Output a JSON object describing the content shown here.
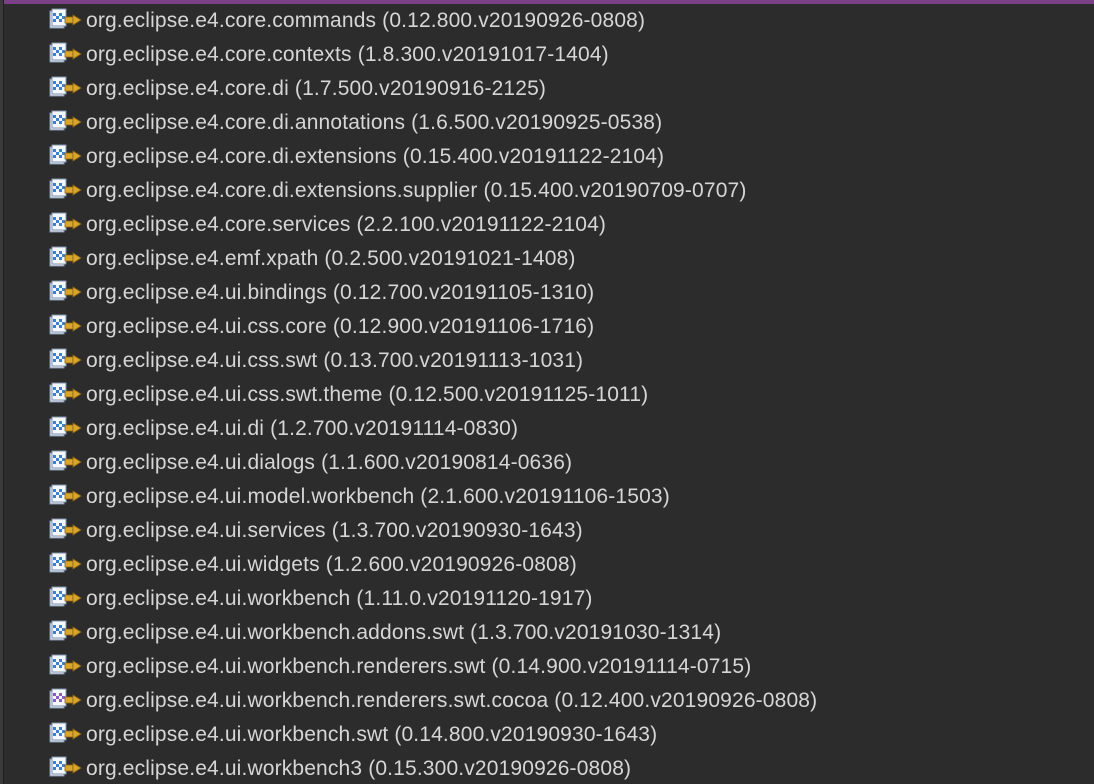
{
  "plugins": [
    {
      "name": "org.eclipse.e4.core.commands",
      "version": "(0.12.800.v20190926-0808)",
      "icon": "plugin-jar-icon"
    },
    {
      "name": "org.eclipse.e4.core.contexts",
      "version": "(1.8.300.v20191017-1404)",
      "icon": "plugin-jar-icon"
    },
    {
      "name": "org.eclipse.e4.core.di",
      "version": "(1.7.500.v20190916-2125)",
      "icon": "plugin-jar-icon"
    },
    {
      "name": "org.eclipse.e4.core.di.annotations",
      "version": "(1.6.500.v20190925-0538)",
      "icon": "plugin-jar-icon"
    },
    {
      "name": "org.eclipse.e4.core.di.extensions",
      "version": "(0.15.400.v20191122-2104)",
      "icon": "plugin-jar-icon"
    },
    {
      "name": "org.eclipse.e4.core.di.extensions.supplier",
      "version": "(0.15.400.v20190709-0707)",
      "icon": "plugin-jar-icon"
    },
    {
      "name": "org.eclipse.e4.core.services",
      "version": "(2.2.100.v20191122-2104)",
      "icon": "plugin-jar-icon"
    },
    {
      "name": "org.eclipse.e4.emf.xpath",
      "version": "(0.2.500.v20191021-1408)",
      "icon": "plugin-jar-icon"
    },
    {
      "name": "org.eclipse.e4.ui.bindings",
      "version": "(0.12.700.v20191105-1310)",
      "icon": "plugin-jar-icon"
    },
    {
      "name": "org.eclipse.e4.ui.css.core",
      "version": "(0.12.900.v20191106-1716)",
      "icon": "plugin-jar-icon"
    },
    {
      "name": "org.eclipse.e4.ui.css.swt",
      "version": "(0.13.700.v20191113-1031)",
      "icon": "plugin-jar-icon"
    },
    {
      "name": "org.eclipse.e4.ui.css.swt.theme",
      "version": "(0.12.500.v20191125-1011)",
      "icon": "plugin-jar-icon"
    },
    {
      "name": "org.eclipse.e4.ui.di",
      "version": "(1.2.700.v20191114-0830)",
      "icon": "plugin-jar-icon"
    },
    {
      "name": "org.eclipse.e4.ui.dialogs",
      "version": "(1.1.600.v20190814-0636)",
      "icon": "plugin-jar-icon"
    },
    {
      "name": "org.eclipse.e4.ui.model.workbench",
      "version": "(2.1.600.v20191106-1503)",
      "icon": "plugin-jar-icon"
    },
    {
      "name": "org.eclipse.e4.ui.services",
      "version": "(1.3.700.v20190930-1643)",
      "icon": "plugin-jar-icon"
    },
    {
      "name": "org.eclipse.e4.ui.widgets",
      "version": "(1.2.600.v20190926-0808)",
      "icon": "plugin-jar-icon"
    },
    {
      "name": "org.eclipse.e4.ui.workbench",
      "version": "(1.11.0.v20191120-1917)",
      "icon": "plugin-jar-icon"
    },
    {
      "name": "org.eclipse.e4.ui.workbench.addons.swt",
      "version": "(1.3.700.v20191030-1314)",
      "icon": "plugin-jar-icon"
    },
    {
      "name": "org.eclipse.e4.ui.workbench.renderers.swt",
      "version": "(0.14.900.v20191114-0715)",
      "icon": "plugin-jar-icon"
    },
    {
      "name": "org.eclipse.e4.ui.workbench.renderers.swt.cocoa",
      "version": "(0.12.400.v20190926-0808)",
      "icon": "fragment-jar-icon"
    },
    {
      "name": "org.eclipse.e4.ui.workbench.swt",
      "version": "(0.14.800.v20190930-1643)",
      "icon": "plugin-jar-icon"
    },
    {
      "name": "org.eclipse.e4.ui.workbench3",
      "version": "(0.15.300.v20190926-0808)",
      "icon": "plugin-jar-icon"
    }
  ],
  "colors": {
    "background": "#2c2c2c",
    "text": "#d6d6d6",
    "accent_top": "#7a3f86",
    "icon_blue": "#3f7fd0",
    "icon_gold": "#d9a62b",
    "fragment_purple": "#8a5bc9"
  }
}
